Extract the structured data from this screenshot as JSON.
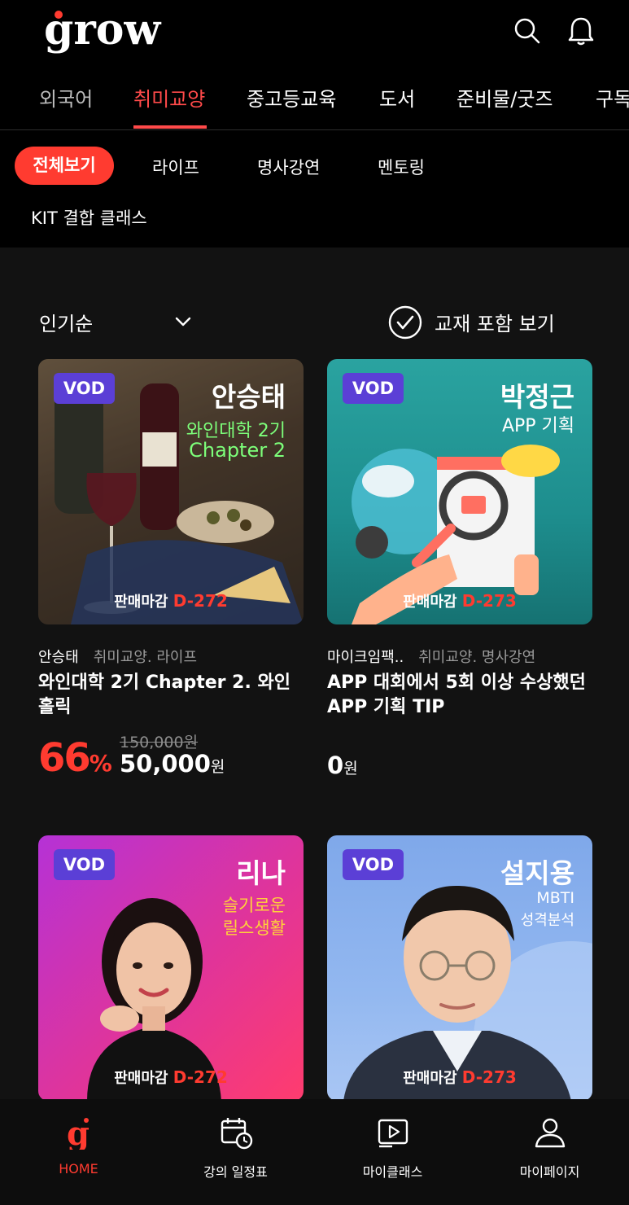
{
  "header": {
    "logo_text": "grow",
    "search_icon": "search-icon",
    "notification_icon": "bell-icon"
  },
  "category_tabs": [
    {
      "label": "외국어",
      "active": false
    },
    {
      "label": "취미교양",
      "active": true
    },
    {
      "label": "중고등교육",
      "active": false
    },
    {
      "label": "도서",
      "active": false
    },
    {
      "label": "준비물/굿즈",
      "active": false
    },
    {
      "label": "구독",
      "active": false
    }
  ],
  "sub_chips": [
    {
      "label": "전체보기",
      "active": true
    },
    {
      "label": "라이프",
      "active": false
    },
    {
      "label": "명사강연",
      "active": false
    },
    {
      "label": "멘토링",
      "active": false
    },
    {
      "label": "KIT 결합 클래스",
      "active": false
    }
  ],
  "sort": {
    "label": "인기순",
    "include_textbook_label": "교재 포함 보기"
  },
  "courses": [
    {
      "badge": "VOD",
      "thumb_name": "안승태",
      "thumb_sub1": "와인대학 2기",
      "thumb_sub2": "Chapter 2",
      "deadline_label": "판매마감",
      "dday": "D-272",
      "instructor": "안승태",
      "category": "취미교양. 라이프",
      "title": "와인대학 2기 Chapter 2. 와인 홀릭",
      "discount": "66",
      "discount_unit": "%",
      "original_price": "150,000원",
      "price": "50,000",
      "price_unit": "원"
    },
    {
      "badge": "VOD",
      "thumb_name": "박정근",
      "thumb_sub1": "APP 기획",
      "deadline_label": "판매마감",
      "dday": "D-273",
      "instructor": "마이크임팩..",
      "category": "취미교양. 명사강연",
      "title": "APP 대회에서 5회 이상 수상했던 APP 기획 TIP",
      "price": "0",
      "price_unit": "원"
    },
    {
      "badge": "VOD",
      "thumb_name": "리나",
      "thumb_sub1": "슬기로운",
      "thumb_sub2": "릴스생활",
      "deadline_label": "판매마감",
      "dday": "D-272"
    },
    {
      "badge": "VOD",
      "thumb_name": "설지용",
      "thumb_sub1": "MBTI",
      "thumb_sub2": "성격분석",
      "deadline_label": "판매마감",
      "dday": "D-273"
    }
  ],
  "bottom_nav": [
    {
      "label": "HOME",
      "icon": "home-g-icon",
      "active": true
    },
    {
      "label": "강의 일정표",
      "icon": "calendar-icon",
      "active": false
    },
    {
      "label": "마이클래스",
      "icon": "play-icon",
      "active": false
    },
    {
      "label": "마이페이지",
      "icon": "user-icon",
      "active": false
    }
  ],
  "colors": {
    "accent": "#ff3b30",
    "vod_badge": "#5b3fd6",
    "background": "#121212"
  }
}
